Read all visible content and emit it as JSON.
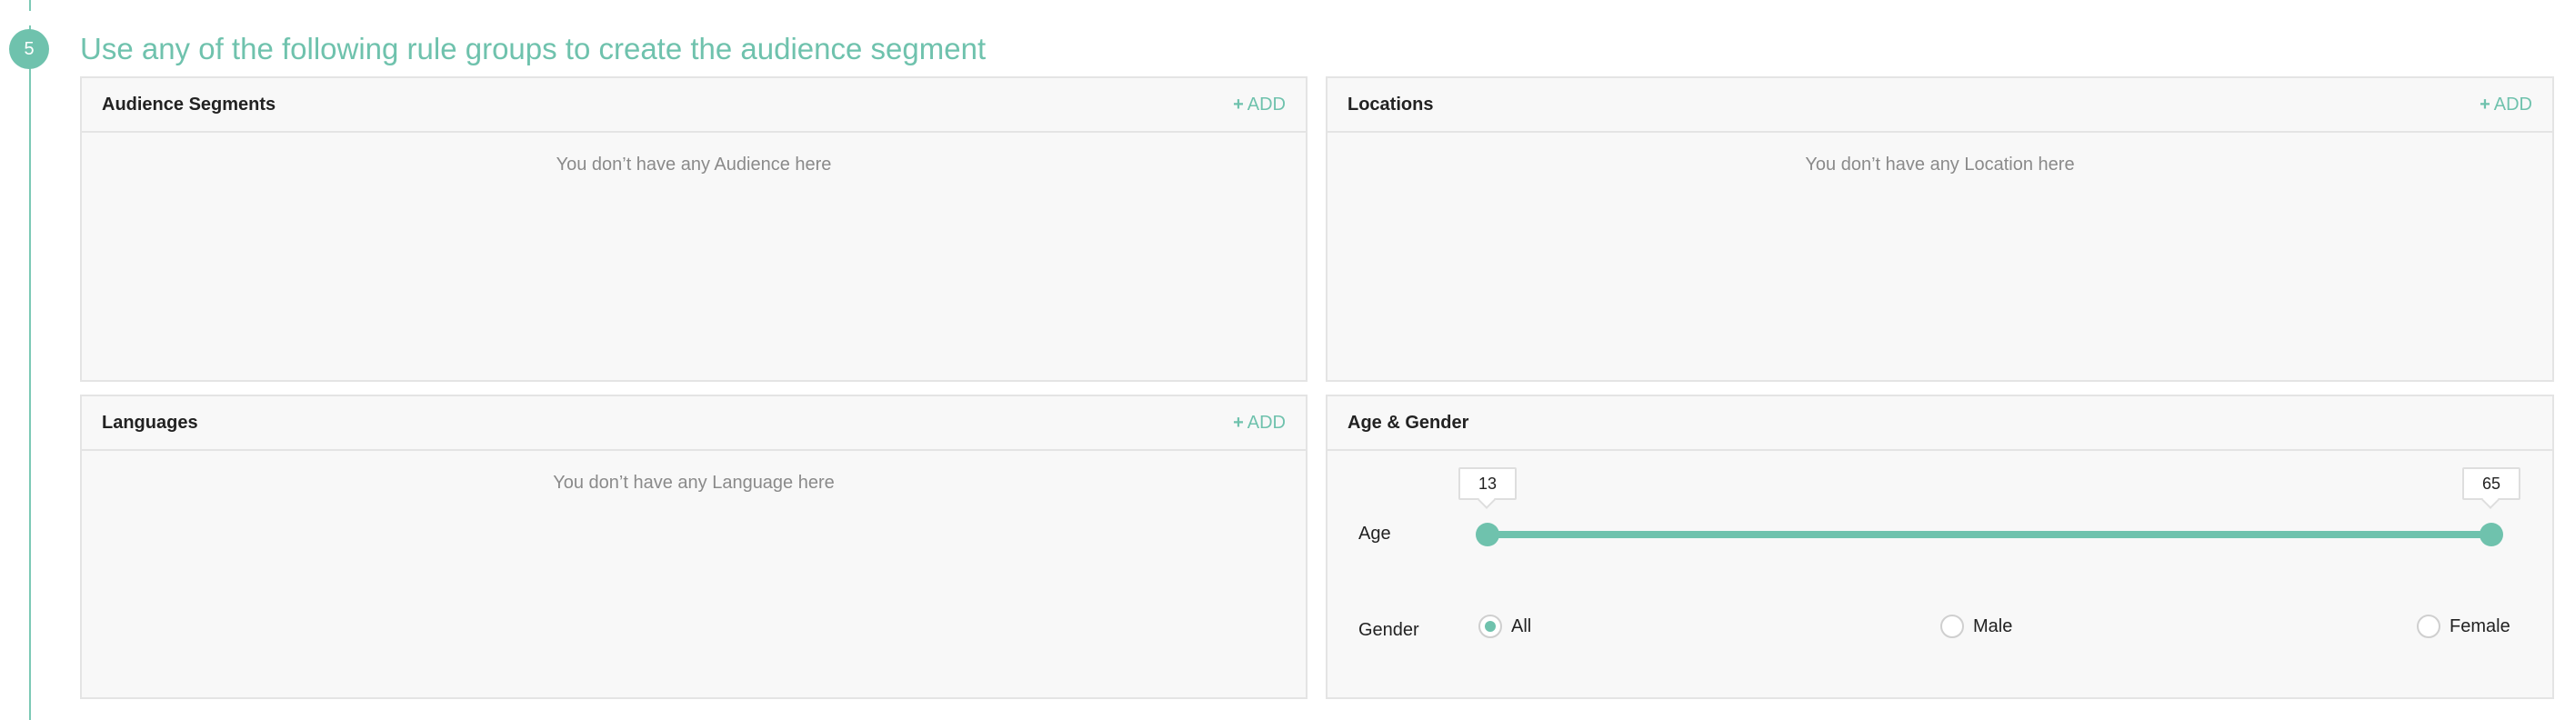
{
  "step": {
    "number": "5",
    "title": "Use any of the following rule groups to create the audience segment"
  },
  "colors": {
    "accent": "#6fc2ad",
    "panel_background": "#f8f8f8",
    "panel_border": "#e4e4e4",
    "muted_text": "#8a8a8a"
  },
  "add_label": "ADD",
  "add_icon": "plus-icon",
  "panels": {
    "audience": {
      "title": "Audience Segments",
      "empty": "You don’t have any Audience here"
    },
    "locations": {
      "title": "Locations",
      "empty": "You don’t have any Location here"
    },
    "languages": {
      "title": "Languages",
      "empty": "You don’t have any Language here"
    },
    "age_gender": {
      "title": "Age & Gender",
      "age_label": "Age",
      "age_min": "13",
      "age_max": "65",
      "gender_label": "Gender",
      "gender_options": [
        "All",
        "Male",
        "Female"
      ],
      "gender_selected": "All"
    }
  }
}
